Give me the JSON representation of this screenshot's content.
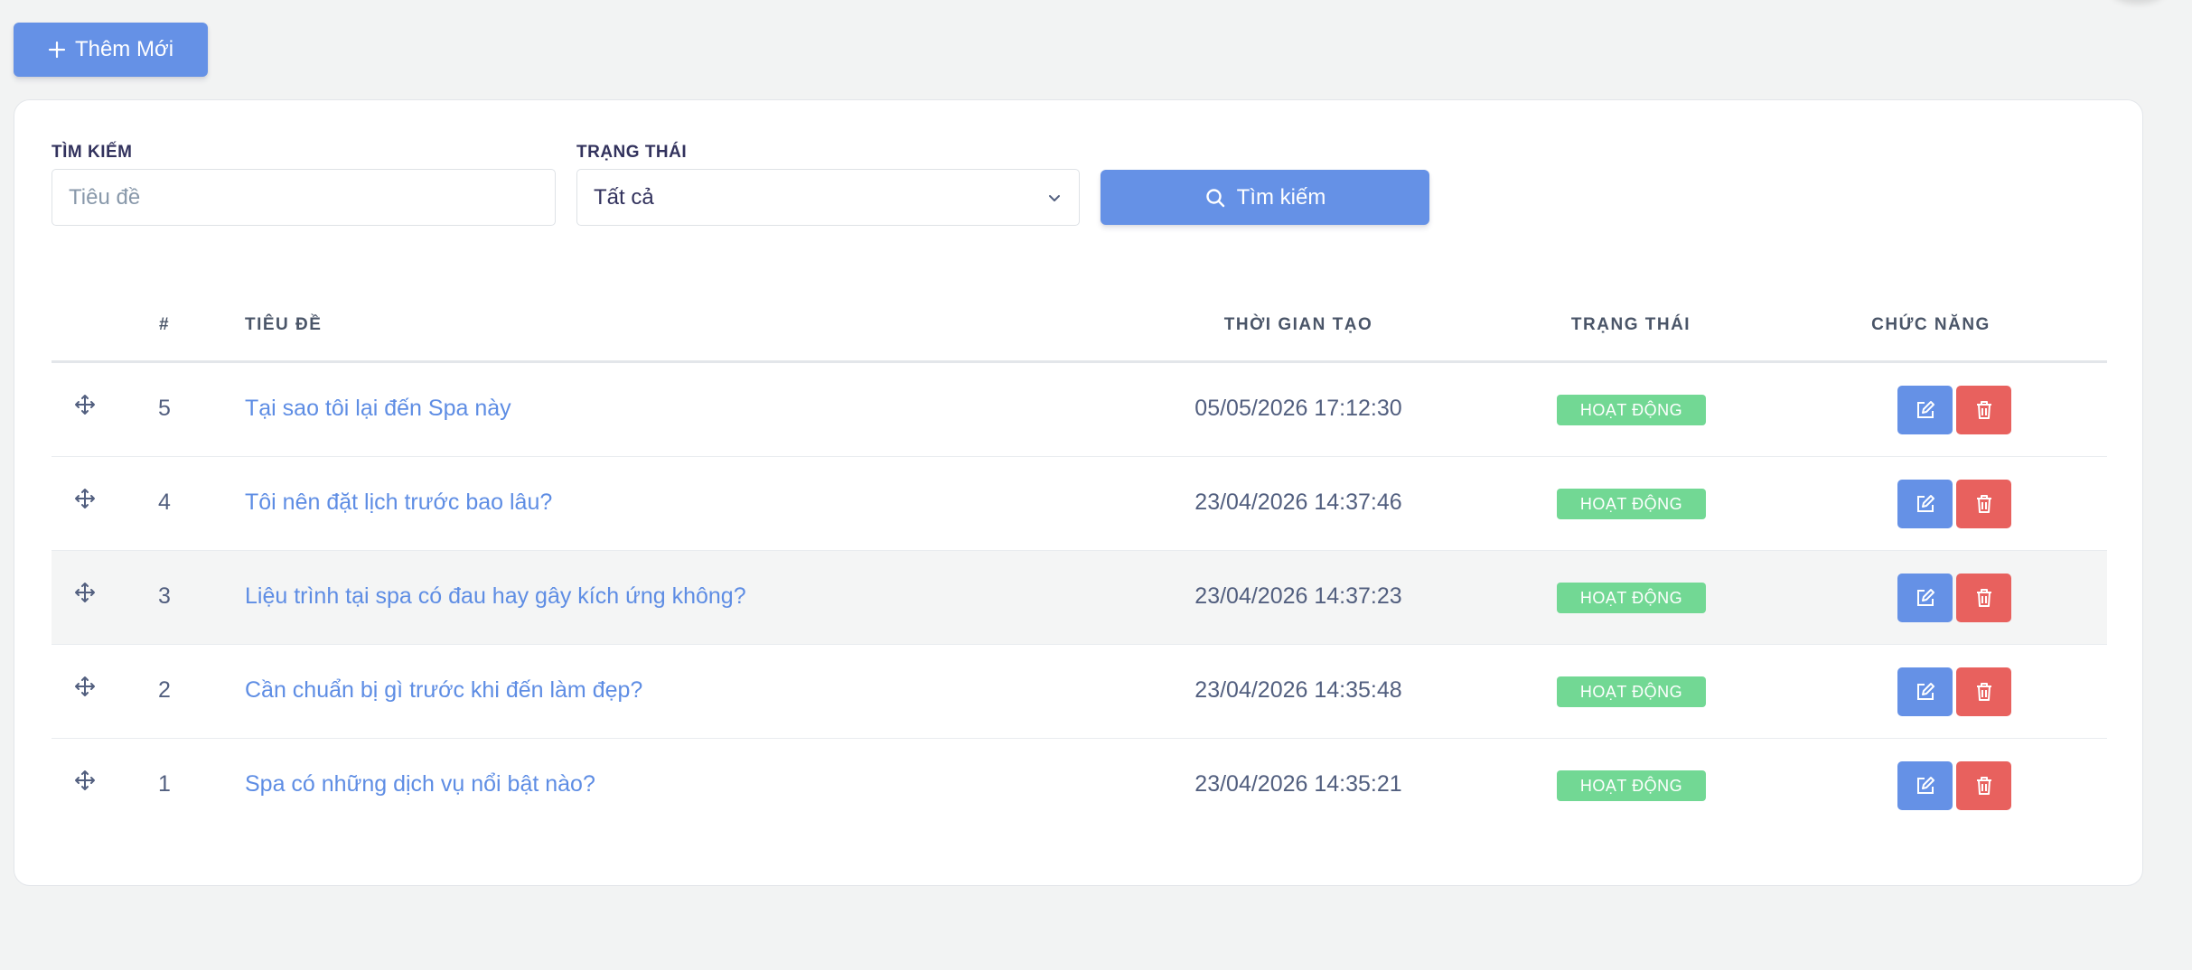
{
  "toolbar": {
    "add_label": "Thêm Mới"
  },
  "filters": {
    "search_label": "TÌM KIẾM",
    "search_placeholder": "Tiêu đề",
    "status_label": "TRẠNG THÁI",
    "status_value": "Tất cả",
    "search_button": "Tìm kiếm"
  },
  "table": {
    "headers": {
      "num": "#",
      "title": "TIÊU ĐỀ",
      "created": "THỜI GIAN TẠO",
      "status": "TRẠNG THÁI",
      "actions": "CHỨC NĂNG"
    },
    "rows": [
      {
        "num": "5",
        "title": "Tại sao tôi lại đến Spa này",
        "created": "05/05/2026 17:12:30",
        "status": "HOẠT ĐỘNG"
      },
      {
        "num": "4",
        "title": "Tôi nên đặt lịch trước bao lâu?",
        "created": "23/04/2026 14:37:46",
        "status": "HOẠT ĐỘNG"
      },
      {
        "num": "3",
        "title": "Liệu trình tại spa có đau hay gây kích ứng không?",
        "created": "23/04/2026 14:37:23",
        "status": "HOẠT ĐỘNG"
      },
      {
        "num": "2",
        "title": "Cần chuẩn bị gì trước khi đến làm đẹp?",
        "created": "23/04/2026 14:35:48",
        "status": "HOẠT ĐỘNG"
      },
      {
        "num": "1",
        "title": "Spa có những dịch vụ nổi bật nào?",
        "created": "23/04/2026 14:35:21",
        "status": "HOẠT ĐỘNG"
      }
    ]
  },
  "icons": {
    "add": "plus-icon",
    "search": "search-icon",
    "select": "chevron-down-icon",
    "drag": "move-icon",
    "edit": "edit-icon",
    "delete": "trash-icon"
  },
  "colors": {
    "primary": "#6591e6",
    "success": "#72d894",
    "danger": "#e8615e",
    "link": "#5e8de4"
  }
}
